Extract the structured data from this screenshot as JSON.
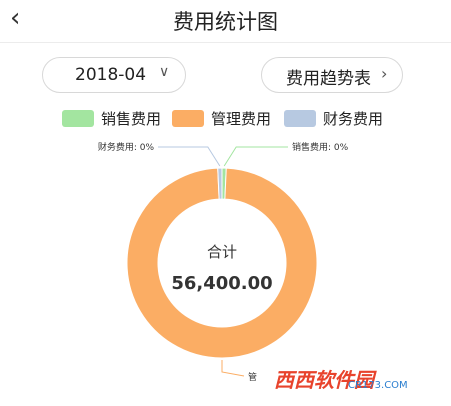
{
  "header": {
    "title": "费用统计图",
    "back_icon": "chevron-left-icon"
  },
  "controls": {
    "date_value": "2018-04",
    "date_icon": "chevron-down-icon",
    "trend_label": "费用趋势表",
    "trend_icon": "chevron-right-icon"
  },
  "legend": [
    {
      "label": "销售费用",
      "color": "#a3e5a0"
    },
    {
      "label": "管理费用",
      "color": "#fbad64"
    },
    {
      "label": "财务费用",
      "color": "#b7c9e1"
    }
  ],
  "chart_data": {
    "type": "pie",
    "style": "donut",
    "categories": [
      "销售费用",
      "管理费用",
      "财务费用"
    ],
    "values": [
      0.0,
      56400.0,
      0.0
    ],
    "colors": [
      "#a3e5a0",
      "#fbad64",
      "#b7c9e1"
    ],
    "slice_labels": [
      "销售费用: 0%",
      "管",
      "财务费用: 0%"
    ],
    "center_label": "合计",
    "center_value": "56,400.00",
    "legend_position": "top"
  },
  "watermark": {
    "text": "西西软件园",
    "url": "CR173.COM"
  }
}
